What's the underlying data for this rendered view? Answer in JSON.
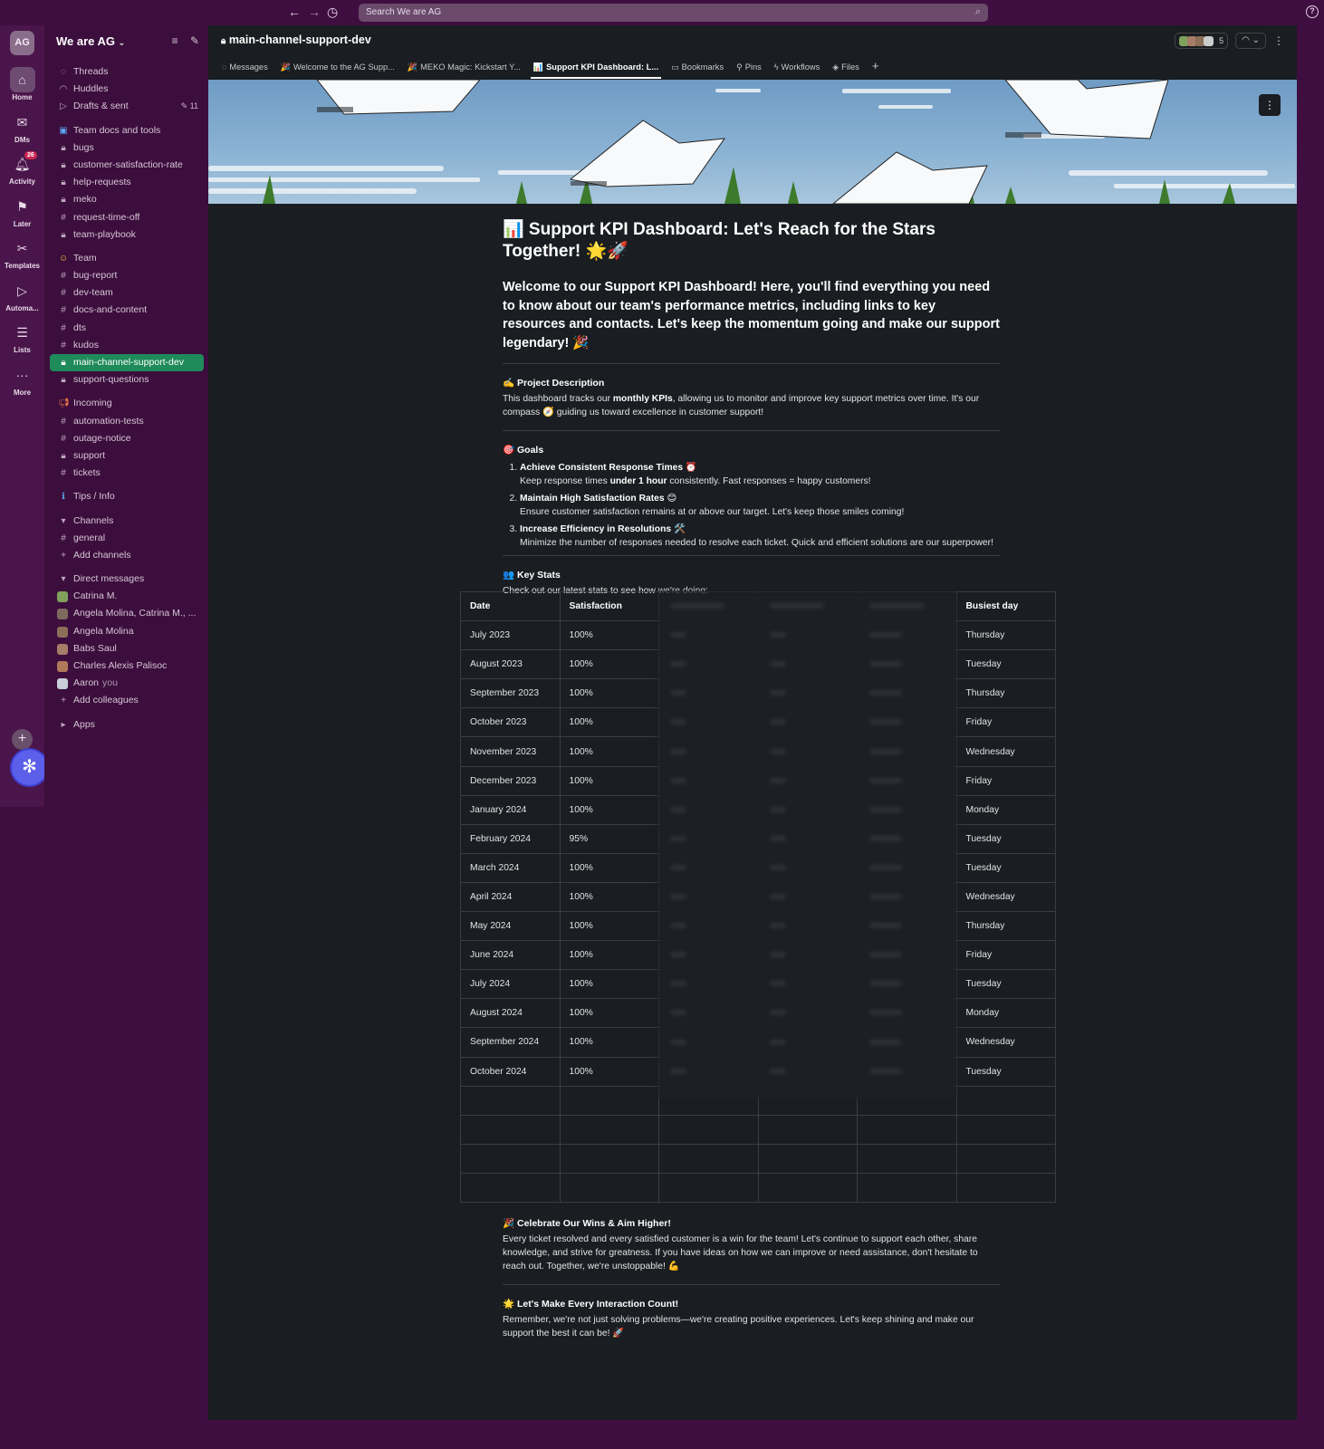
{
  "topbar": {
    "search_placeholder": "Search We are AG"
  },
  "rail": {
    "workspace_initials": "AG",
    "items": [
      {
        "label": "Home"
      },
      {
        "label": "DMs"
      },
      {
        "label": "Activity",
        "badge": "26"
      },
      {
        "label": "Later"
      },
      {
        "label": "Templates"
      },
      {
        "label": "Automa..."
      },
      {
        "label": "Lists"
      },
      {
        "label": "More"
      }
    ]
  },
  "sidebar": {
    "workspace": "We are AG",
    "top": [
      {
        "label": "Threads"
      },
      {
        "label": "Huddles"
      },
      {
        "label": "Drafts & sent",
        "count": "11"
      }
    ],
    "group1": [
      "Team docs and tools",
      "bugs",
      "customer-satisfaction-rate",
      "help-requests",
      "meko",
      "request-time-off",
      "team-playbook"
    ],
    "group2": [
      "Team",
      "bug-report",
      "dev-team",
      "docs-and-content",
      "dts",
      "kudos",
      "main-channel-support-dev",
      "support-questions"
    ],
    "group3": [
      "Incoming",
      "automation-tests",
      "outage-notice",
      "support",
      "tickets"
    ],
    "tips": "Tips / Info",
    "channels_header": "Channels",
    "channels": [
      "general"
    ],
    "add_channels": "Add channels",
    "dm_header": "Direct messages",
    "dms": [
      "Catrina M.",
      "Angela Molina, Catrina M., ...",
      "Angela Molina",
      "Babs Saul",
      "Charles Alexis Palisoc",
      "Aaron"
    ],
    "you_label": "you",
    "add_colleagues": "Add colleagues",
    "apps": "Apps"
  },
  "channel": {
    "name": "main-channel-support-dev",
    "member_count": "5",
    "tabs": [
      "Messages",
      "Welcome to the AG Supp...",
      "MEKO Magic: Kickstart Y...",
      "Support KPI Dashboard: L...",
      "Bookmarks",
      "Pins",
      "Workflows",
      "Files"
    ]
  },
  "doc": {
    "title": "📊 Support KPI Dashboard: Let's Reach for the Stars Together! 🌟🚀",
    "intro": "Welcome to our Support KPI Dashboard! Here, you'll find everything you need to know about our team's performance metrics, including links to key resources and contacts. Let's keep the momentum going and make our support legendary! 🎉",
    "project_title": "✍️ Project Description",
    "project_body_1": "This dashboard tracks our ",
    "project_body_bold": "monthly KPIs",
    "project_body_2": ", allowing us to monitor and improve key support metrics over time. It's our compass 🧭 guiding us toward excellence in customer support!",
    "goals_title": "🎯 Goals",
    "goals": [
      {
        "title": "Achieve Consistent Response Times ⏰",
        "body_1": "Keep response times ",
        "body_bold": "under 1 hour",
        "body_2": " consistently. Fast responses = happy customers!"
      },
      {
        "title": "Maintain High Satisfaction Rates 😊",
        "body_1": "Ensure customer satisfaction remains at or above our target. Let's keep those smiles coming!",
        "body_bold": "",
        "body_2": ""
      },
      {
        "title": "Increase Efficiency in Resolutions 🛠️",
        "body_1": "Minimize the number of responses needed to resolve each ticket. Quick and efficient solutions are our superpower!",
        "body_bold": "",
        "body_2": ""
      }
    ],
    "stats_title": "👥 Key Stats",
    "stats_body": "Check out our latest stats to see how we're doing:",
    "table": {
      "headers": [
        "Date",
        "Satisfaction",
        "",
        "",
        "",
        "Busiest day"
      ],
      "rows": [
        [
          "July 2023",
          "100%",
          "Thursday"
        ],
        [
          "August 2023",
          "100%",
          "Tuesday"
        ],
        [
          "September 2023",
          "100%",
          "Thursday"
        ],
        [
          "October 2023",
          "100%",
          "Friday"
        ],
        [
          "November 2023",
          "100%",
          "Wednesday"
        ],
        [
          "December 2023",
          "100%",
          "Friday"
        ],
        [
          "January 2024",
          "100%",
          "Monday"
        ],
        [
          "February 2024",
          "95%",
          "Tuesday"
        ],
        [
          "March 2024",
          "100%",
          "Tuesday"
        ],
        [
          "April 2024",
          "100%",
          "Wednesday"
        ],
        [
          "May 2024",
          "100%",
          "Thursday"
        ],
        [
          "June 2024",
          "100%",
          "Friday"
        ],
        [
          "July 2024",
          "100%",
          "Tuesday"
        ],
        [
          "August 2024",
          "100%",
          "Monday"
        ],
        [
          "September 2024",
          "100%",
          "Wednesday"
        ],
        [
          "October 2024",
          "100%",
          "Tuesday"
        ]
      ],
      "empty_rows": 4
    },
    "celebrate_title": "🎉 Celebrate Our Wins & Aim Higher!",
    "celebrate_body": "Every ticket resolved and every satisfied customer is a win for the team! Let's continue to support each other, share knowledge, and strive for greatness. If you have ideas on how we can improve or need assistance, don't hesitate to reach out. Together, we're unstoppable! 💪",
    "count_title": "🌟 Let's Make Every Interaction Count!",
    "count_body": "Remember, we're not just solving problems—we're creating positive experiences. Let's keep shining and make our support the best it can be! 🚀"
  },
  "colors": {
    "app_bg": "#3f0e40",
    "sidebar_bg": "#3c0e3d",
    "active_channel": "#1f8a5a",
    "content_bg": "#1a1d21",
    "accent_button": "#5b5fe9"
  }
}
